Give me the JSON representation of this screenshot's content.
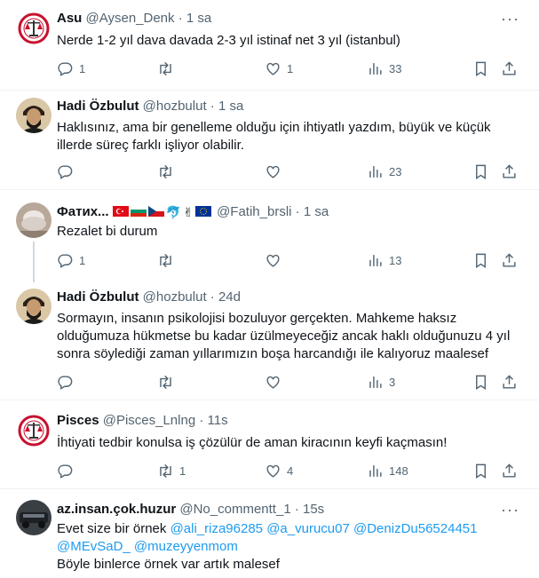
{
  "tweets": [
    {
      "name": "Asu",
      "handle": "@Aysen_Denk",
      "time": "1 sa",
      "text": "Nerde 1-2 yıl dava davada 2-3 yıl istinaf net 3 yıl (istanbul)",
      "replies": "1",
      "retweets": "",
      "likes": "1",
      "views": "33"
    },
    {
      "name": "Hadi Özbulut",
      "handle": "@hozbulut",
      "time": "1 sa",
      "text": "Haklısınız, ama bir genelleme olduğu için ihtiyatlı yazdım, büyük ve küçük illerde süreç farklı işliyor olabilir.",
      "replies": "",
      "retweets": "",
      "likes": "",
      "views": "23"
    },
    {
      "name": "Фатих...",
      "handle": "@Fatih_brsli",
      "time": "1 sa",
      "text": "Rezalet bi durum",
      "replies": "1",
      "retweets": "",
      "likes": "",
      "views": "13",
      "emoji": [
        "✌",
        "🐬"
      ],
      "flag_colors": {
        "tr": "#e30a17",
        "bg": [
          "#ffffff",
          "#00966e",
          "#d62612"
        ],
        "cz": [
          "#ffffff",
          "#d7141a",
          "#11457e"
        ],
        "eu": "#003399"
      }
    },
    {
      "name": "Hadi Özbulut",
      "handle": "@hozbulut",
      "time": "24d",
      "text": "Sormayın, insanın psikolojisi bozuluyor gerçekten. Mahkeme haksız olduğumuza hükmetse bu kadar üzülmeyeceğiz ancak haklı olduğunuzu 4 yıl sonra söylediği zaman yıllarımızın boşa harcandığı ile kalıyoruz maalesef",
      "replies": "",
      "retweets": "",
      "likes": "",
      "views": "3"
    },
    {
      "name": "Pisces",
      "handle": "@Pisces_Lnlng",
      "time": "11s",
      "text": "İhtiyati tedbir konulsa iş çözülür de aman kiracının keyfi kaçmasın!",
      "replies": "",
      "retweets": "1",
      "likes": "4",
      "views": "148"
    },
    {
      "name": "az.insan.çok.huzur",
      "handle": "@No_commentt_1",
      "time": "15s",
      "text_line1": "Evet size bir örnek",
      "mentions": [
        "@ali_riza96285",
        "@a_vurucu07",
        "@DenizDu56524451",
        "@MEvSaD_",
        "@muzeyyenmom"
      ],
      "text_line3": "Böyle binlerce örnek var artık malesef",
      "replies": "",
      "retweets": "",
      "likes": "",
      "views": ""
    }
  ],
  "separator": "·",
  "more": "···",
  "icons": {
    "reply": "reply-icon",
    "retweet": "retweet-icon",
    "like": "heart-icon",
    "views": "views-icon",
    "bookmark": "bookmark-icon",
    "share": "share-icon"
  },
  "colors": {
    "text": "#0f1419",
    "secondary": "#536471",
    "link": "#1d9bf0",
    "thread": "#cfd9de",
    "divider": "#eff3f4"
  }
}
